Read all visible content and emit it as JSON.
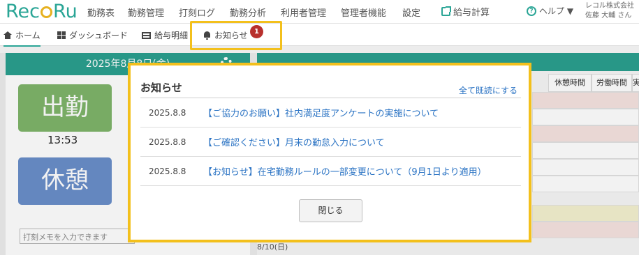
{
  "app": {
    "logo": "RecoRu",
    "company": "レコル株式会社",
    "user": "佐藤 大輔 さん"
  },
  "topnav": {
    "items": [
      "勤務表",
      "勤務管理",
      "打刻ログ",
      "勤務分析",
      "利用者管理",
      "管理者機能",
      "設定"
    ],
    "payroll": "給与計算",
    "help": "ヘルプ ▼"
  },
  "subnav": {
    "tabs": [
      "ホーム",
      "ダッシュボード",
      "給与明細",
      "お知らせ"
    ],
    "badge_count": "1"
  },
  "home": {
    "date": "2025年8月8日(金)",
    "clock_in": "出勤",
    "clock_in_time": "13:53",
    "break": "休憩",
    "memo_placeholder": "打刻メモを入力できます"
  },
  "table": {
    "headers": [
      "休憩時間",
      "労働時間",
      "実"
    ],
    "date_label": "8/10(日)"
  },
  "modal": {
    "title": "お知らせ",
    "mark_all_read": "全て既読にする",
    "notices": [
      {
        "date": "2025.8.8",
        "text": "【ご協力のお願い】社内満足度アンケートの実施について"
      },
      {
        "date": "2025.8.8",
        "text": "【ご確認ください】月末の勤怠入力について"
      },
      {
        "date": "2025.8.8",
        "text": "【お知らせ】在宅勤務ルールの一部変更について（9月1日より適用）"
      }
    ],
    "close": "閉じる"
  },
  "colors": {
    "brand_teal": "#2ba08f",
    "highlight_yellow": "#f3c01c",
    "link_blue": "#2c74c4",
    "badge_red": "#b8302d",
    "clock_in_green": "#7fb56a",
    "break_blue": "#6a8fca"
  }
}
